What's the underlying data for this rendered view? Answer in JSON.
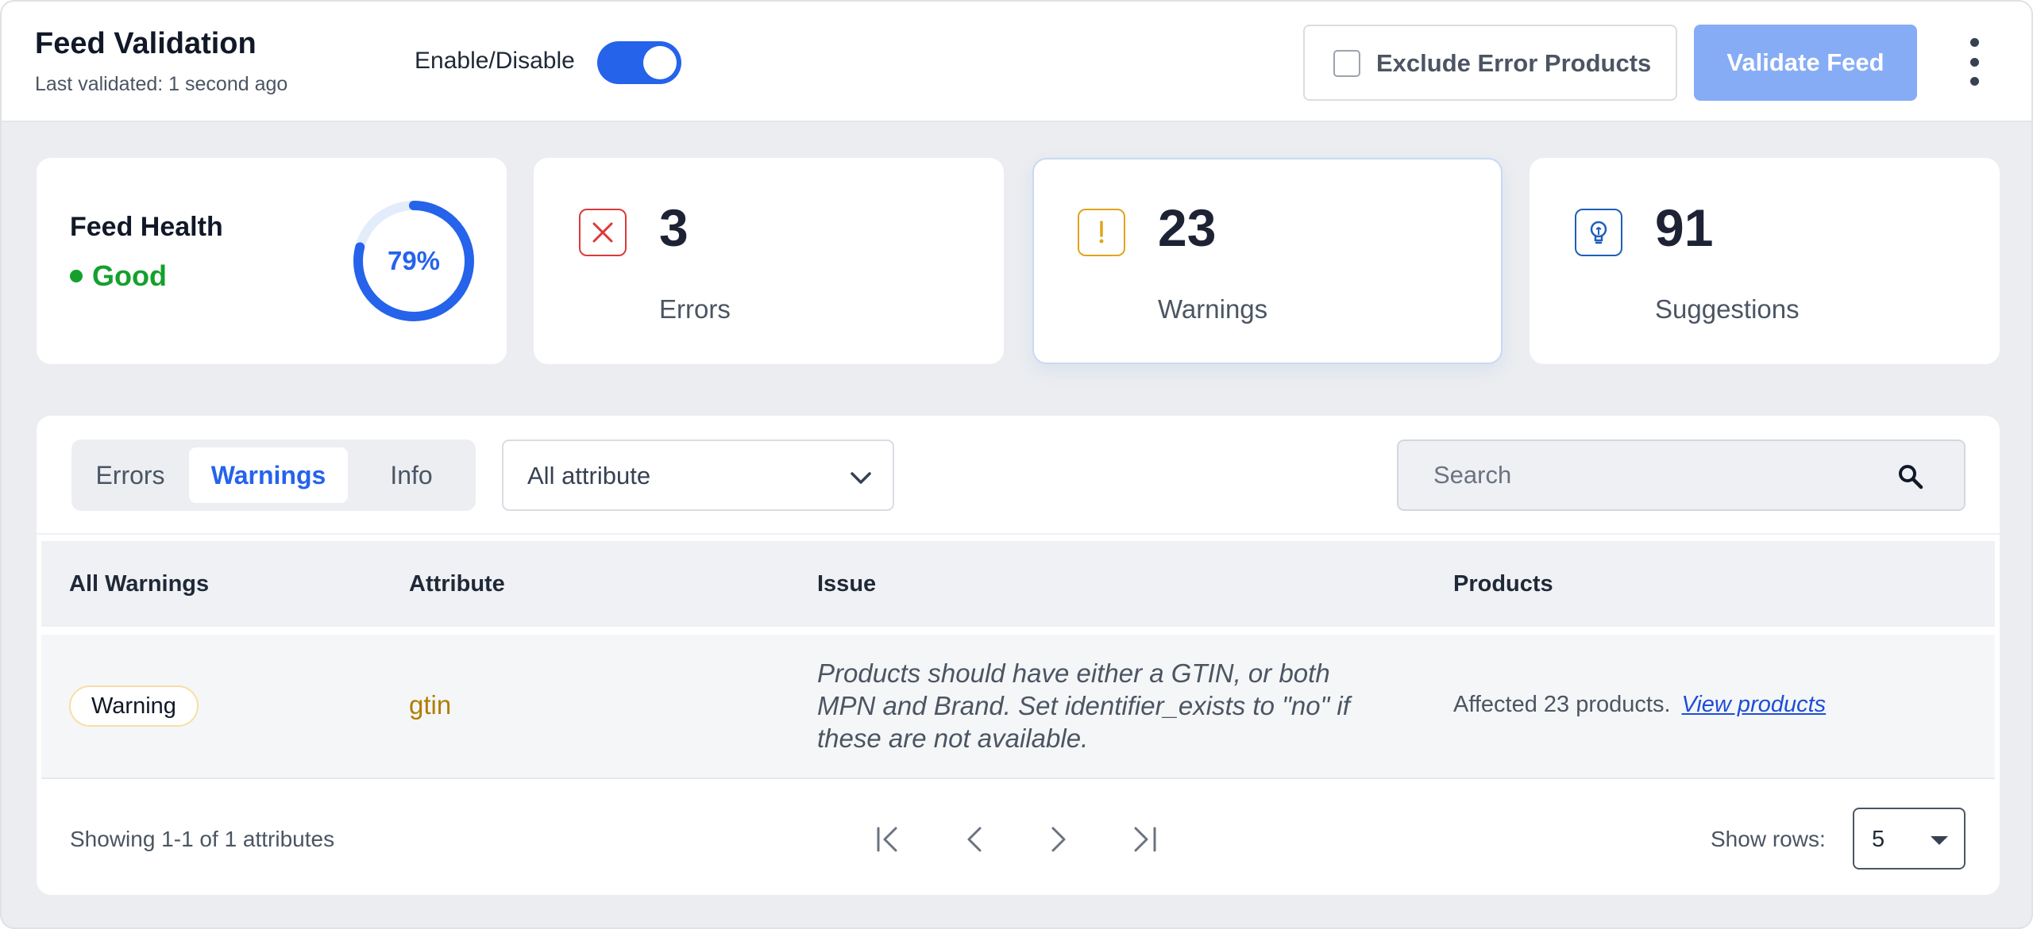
{
  "header": {
    "title": "Feed Validation",
    "last_validated": "Last validated: 1 second ago",
    "toggle_label": "Enable/Disable",
    "toggle_on": true,
    "exclude_label": "Exclude Error Products",
    "exclude_checked": false,
    "validate_label": "Validate Feed",
    "menu_icon": "kebab-menu-icon"
  },
  "stats": {
    "health": {
      "title": "Feed Health",
      "status": "Good",
      "percent_label": "79%",
      "percent": 79,
      "status_color": "#14a02d"
    },
    "errors": {
      "count": "3",
      "label": "Errors",
      "icon": "x-icon",
      "color": "#dc3a3a"
    },
    "warnings": {
      "count": "23",
      "label": "Warnings",
      "icon": "exclamation-icon",
      "color": "#e0a51b"
    },
    "suggestions": {
      "count": "91",
      "label": "Suggestions",
      "icon": "lightbulb-icon",
      "color": "#1f5fb8"
    }
  },
  "filters": {
    "tabs": [
      {
        "label": "Errors",
        "active": false
      },
      {
        "label": "Warnings",
        "active": true
      },
      {
        "label": "Info",
        "active": false
      }
    ],
    "attribute_select": "All attribute",
    "search_placeholder": "Search"
  },
  "table": {
    "columns": [
      "All Warnings",
      "Attribute",
      "Issue",
      "Products"
    ],
    "rows": [
      {
        "severity": "Warning",
        "attribute": "gtin",
        "issue": "Products should have either a GTIN, or both MPN and Brand. Set identifier_exists to \"no\" if these are not available.",
        "affected": "Affected 23 products.",
        "link": "View products"
      }
    ]
  },
  "footer": {
    "showing": "Showing 1-1 of 1 attributes",
    "rows_label": "Show rows:",
    "rows_value": "5"
  },
  "colors": {
    "accent": "#2563eb",
    "validate_button": "#86acf6",
    "background": "#ebedf0"
  }
}
